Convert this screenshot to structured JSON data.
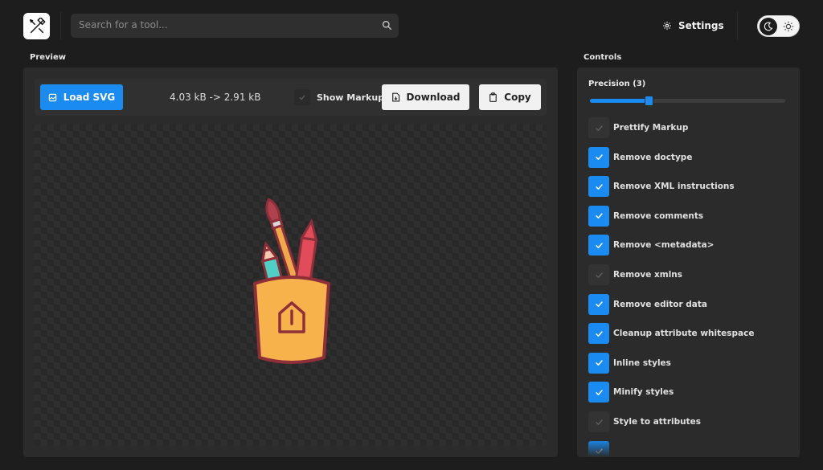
{
  "header": {
    "search_placeholder": "Search for a tool...",
    "settings_label": "Settings"
  },
  "preview": {
    "section_title": "Preview",
    "load_button": "Load SVG",
    "size_text": "4.03 kB -> 2.91 kB",
    "show_markup_label": "Show Markup",
    "show_markup_checked": false,
    "download_button": "Download",
    "copy_button": "Copy"
  },
  "controls": {
    "section_title": "Controls",
    "precision_label": "Precision (3)",
    "precision_fraction": 0.3,
    "options": [
      {
        "label": "Prettify Markup",
        "checked": false
      },
      {
        "label": "Remove doctype",
        "checked": true
      },
      {
        "label": "Remove XML instructions",
        "checked": true
      },
      {
        "label": "Remove comments",
        "checked": true
      },
      {
        "label": "Remove <metadata>",
        "checked": true
      },
      {
        "label": "Remove xmlns",
        "checked": false
      },
      {
        "label": "Remove editor data",
        "checked": true
      },
      {
        "label": "Cleanup attribute whitespace",
        "checked": true
      },
      {
        "label": "Inline styles",
        "checked": true
      },
      {
        "label": "Minify styles",
        "checked": true
      },
      {
        "label": "Style to attributes",
        "checked": false
      },
      {
        "label": "",
        "checked": true
      }
    ]
  },
  "colors": {
    "accent": "#1a8bf0",
    "background": "#1d1d1d",
    "panel": "#2b2b2b"
  }
}
